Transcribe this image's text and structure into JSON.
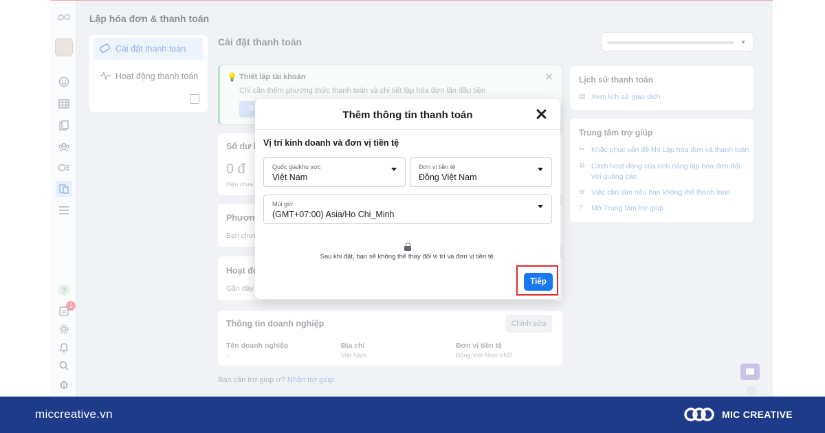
{
  "header": {
    "page_title": "Lập hóa đơn & thanh toán"
  },
  "nav": {
    "items": [
      {
        "label": "Cài đặt thanh toán",
        "icon": "card-icon",
        "active": true
      },
      {
        "label": "Hoạt động thanh toán",
        "icon": "activity-icon",
        "active": false
      }
    ]
  },
  "main": {
    "title": "Cài đặt thanh toán",
    "setup": {
      "title": "Thiết lập tài khoản",
      "desc": "Chỉ cần thêm phương thức thanh toán và chi tiết lập hóa đơn lần đầu tiên",
      "button_label": "Bắ"
    },
    "balance": {
      "title": "Số dư h",
      "amount": "0 đ",
      "sub": "Hiện chưa"
    },
    "payment_method": {
      "title": "Phương",
      "sub": "Bạn chưa"
    },
    "activity": {
      "title": "Hoạt độ",
      "sub": "Gần đây b"
    },
    "business": {
      "title": "Thông tin doanh nghiệp",
      "edit_label": "Chỉnh sửa",
      "columns": [
        {
          "header": "Tên doanh nghiệp",
          "value": "-"
        },
        {
          "header": "Địa chỉ",
          "value": "Việt Nam"
        },
        {
          "header": "Đơn vị tiền tệ",
          "value": "Đồng Việt Nam VND"
        }
      ]
    },
    "help": {
      "text": "Bạn cần trợ giúp ư?",
      "link": "Nhận trợ giúp"
    }
  },
  "right": {
    "history": {
      "title": "Lịch sử thanh toán",
      "link": "Xem lịch sử giao dịch"
    },
    "help_center": {
      "title": "Trung tâm trợ giúp",
      "links": [
        "Khắc phục vấn đề khi Lập hóa đơn và thanh toán",
        "Cách hoạt động của tính năng lập hóa đơn đối",
        "với quảng cáo",
        "Việc cần làm nếu bạn không thể thanh toán",
        "Mở Trung tâm trợ giúp"
      ]
    }
  },
  "rail": {
    "badge_count": "1",
    "help_glyph": "?"
  },
  "modal": {
    "title": "Thêm thông tin thanh toán",
    "section": "Vị trí kinh doanh và đơn vị tiền tệ",
    "country": {
      "label": "Quốc gia/khu vực",
      "value": "Việt Nam"
    },
    "currency": {
      "label": "Đơn vị tiền tệ",
      "value": "Đồng Việt Nam"
    },
    "timezone": {
      "label": "Múi giờ",
      "value": "(GMT+07:00) Asia/Ho Chi_Minh"
    },
    "note": "Sau khi đặt, bạn sẽ không thể thay đổi vị trí và đơn vị tiền tệ.",
    "next_label": "Tiếp"
  },
  "footer": {
    "url": "miccreative.vn",
    "brand": "MIC CREATIVE"
  },
  "colors": {
    "primary": "#1877f2",
    "highlight": "#e02a2a",
    "footer": "#1e3b8a"
  }
}
